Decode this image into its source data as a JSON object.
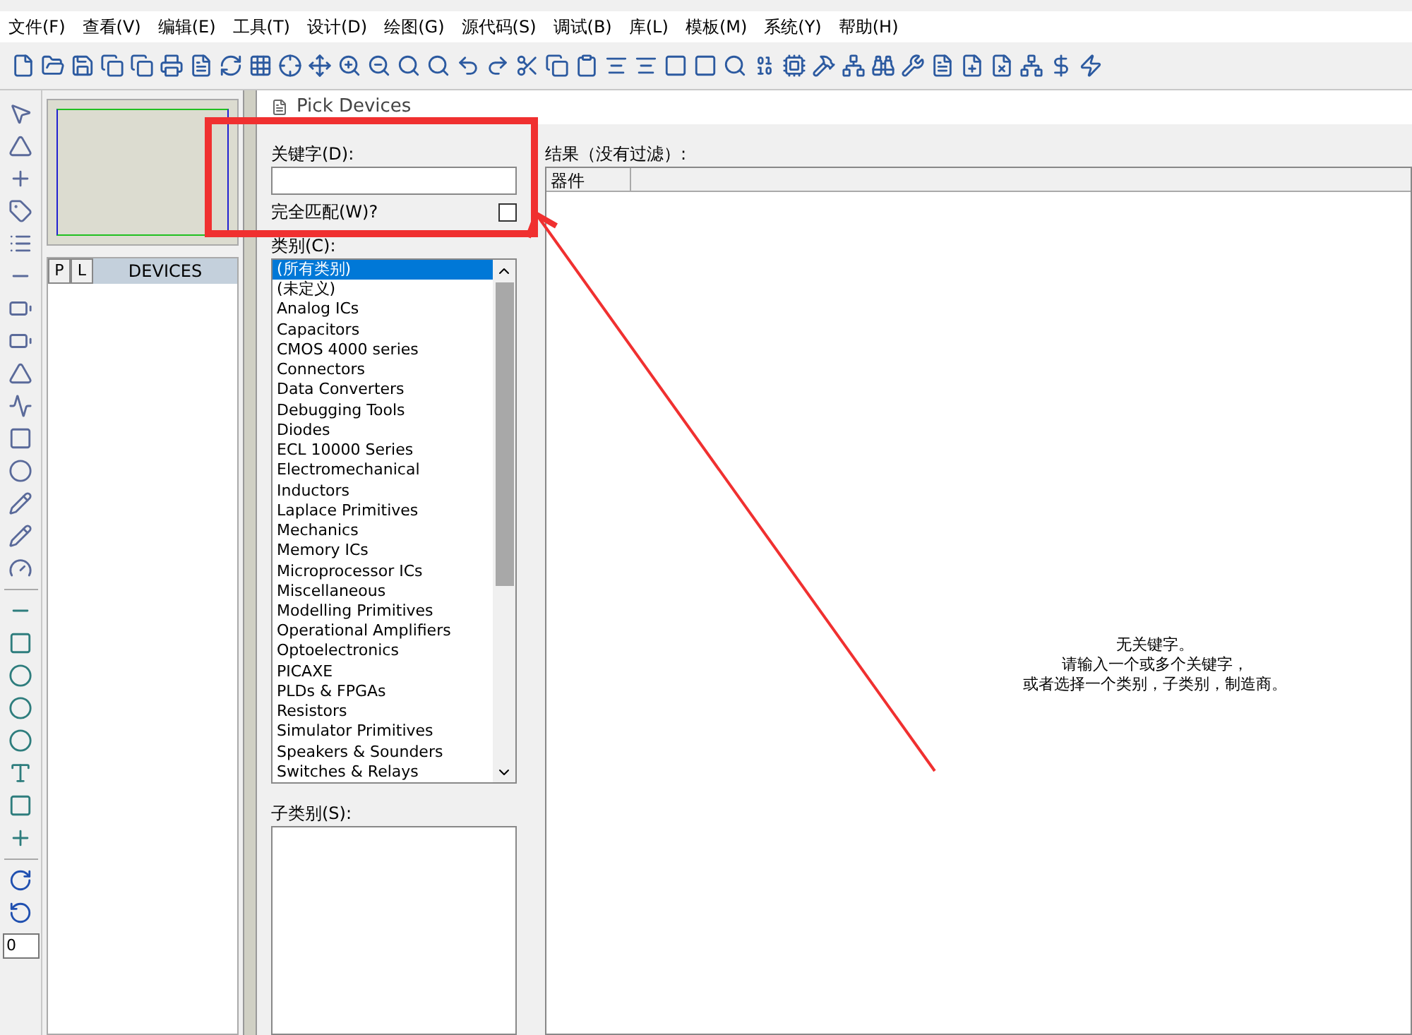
{
  "menu": [
    "文件(F)",
    "查看(V)",
    "编辑(E)",
    "工具(T)",
    "设计(D)",
    "绘图(G)",
    "源代码(S)",
    "调试(B)",
    "库(L)",
    "模板(M)",
    "系统(Y)",
    "帮助(H)"
  ],
  "left_toolbar": {
    "rotation_value": "0"
  },
  "devices_panel": {
    "tabs": [
      {
        "label": "P",
        "selected": false
      },
      {
        "label": "L",
        "selected": false
      }
    ],
    "title": "DEVICES"
  },
  "dialog": {
    "title": "Pick Devices",
    "keyword": {
      "label": "关键字(D):"
    },
    "exact_match": {
      "label": "完全匹配(W)?",
      "checked": false
    },
    "category": {
      "label": "类别(C):",
      "items": [
        {
          "label": "(所有类别)",
          "selected": true
        },
        {
          "label": "(未定义)",
          "selected": false
        },
        {
          "label": "Analog ICs",
          "selected": false
        },
        {
          "label": "Capacitors",
          "selected": false
        },
        {
          "label": "CMOS 4000 series",
          "selected": false
        },
        {
          "label": "Connectors",
          "selected": false
        },
        {
          "label": "Data Converters",
          "selected": false
        },
        {
          "label": "Debugging Tools",
          "selected": false
        },
        {
          "label": "Diodes",
          "selected": false
        },
        {
          "label": "ECL 10000 Series",
          "selected": false
        },
        {
          "label": "Electromechanical",
          "selected": false
        },
        {
          "label": "Inductors",
          "selected": false
        },
        {
          "label": "Laplace Primitives",
          "selected": false
        },
        {
          "label": "Mechanics",
          "selected": false
        },
        {
          "label": "Memory ICs",
          "selected": false
        },
        {
          "label": "Microprocessor ICs",
          "selected": false
        },
        {
          "label": "Miscellaneous",
          "selected": false
        },
        {
          "label": "Modelling Primitives",
          "selected": false
        },
        {
          "label": "Operational Amplifiers",
          "selected": false
        },
        {
          "label": "Optoelectronics",
          "selected": false
        },
        {
          "label": "PICAXE",
          "selected": false
        },
        {
          "label": "PLDs & FPGAs",
          "selected": false
        },
        {
          "label": "Resistors",
          "selected": false
        },
        {
          "label": "Simulator Primitives",
          "selected": false
        },
        {
          "label": "Speakers & Sounders",
          "selected": false
        },
        {
          "label": "Switches & Relays",
          "selected": false
        }
      ]
    },
    "subcategory": {
      "label": "子类别(S):"
    },
    "results": {
      "label": "结果（没有过滤）:",
      "columns": [
        "器件"
      ],
      "message": [
        "无关键字。",
        "请输入一个或多个关键字，",
        "或者选择一个类别，子类别，制造商。"
      ]
    }
  }
}
